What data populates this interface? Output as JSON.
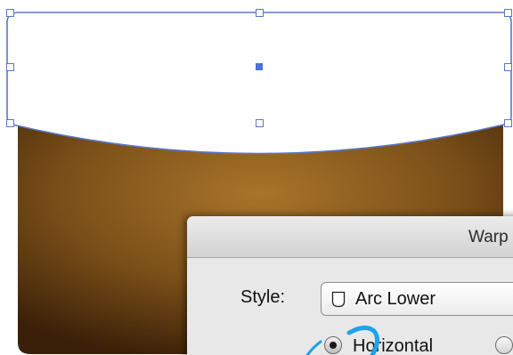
{
  "dialog": {
    "title": "Warp",
    "style_label": "Style:",
    "style_value": "Arc Lower",
    "style_icon": "arc-lower-icon",
    "orientation_options": [
      {
        "label": "Horizontal",
        "selected": true
      },
      {
        "label": "",
        "selected": false
      }
    ]
  },
  "colors": {
    "selection": "#5a78c8",
    "shape_gradient_center": "#a8742a",
    "shape_gradient_edge": "#3a2008",
    "annotation": "#1fa3e8"
  }
}
